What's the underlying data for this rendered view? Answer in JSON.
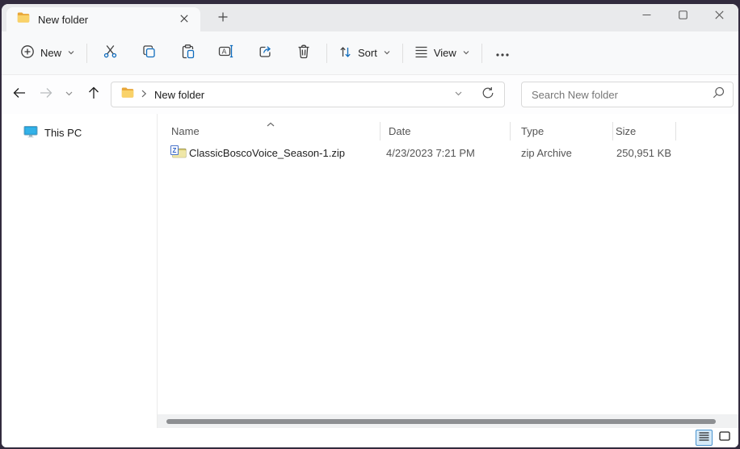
{
  "tab_bar": {
    "active_tab": {
      "title": "New folder"
    }
  },
  "toolbar": {
    "new_label": "New",
    "sort_label": "Sort",
    "view_label": "View"
  },
  "address_bar": {
    "breadcrumb_folder": "New folder"
  },
  "search": {
    "placeholder": "Search New folder"
  },
  "sidebar": {
    "items": [
      {
        "label": "This PC"
      }
    ]
  },
  "file_list": {
    "columns": [
      {
        "label": "Name"
      },
      {
        "label": "Date"
      },
      {
        "label": "Type"
      },
      {
        "label": "Size"
      }
    ],
    "rows": [
      {
        "name": "ClassicBoscoVoice_Season-1.zip",
        "date": "4/23/2023 7:21 PM",
        "type": "zip Archive",
        "size": "250,951 KB"
      }
    ]
  },
  "icons": {
    "zip_icon_letter": "Z",
    "rename_icon_letter": "A"
  },
  "colors": {
    "accent_blue": "#0f6cbd",
    "frame_backdrop": "#322b3e",
    "selected_view_bg": "#d6eaf8"
  }
}
